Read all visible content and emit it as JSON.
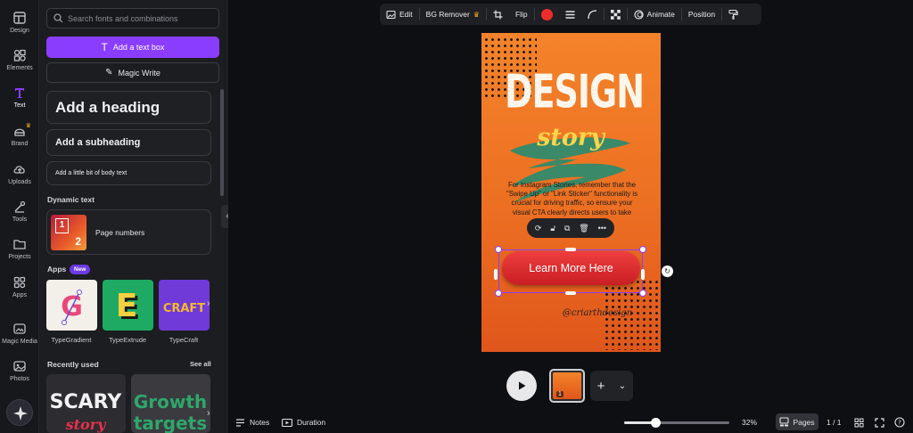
{
  "rail": {
    "items": [
      {
        "label": "Design",
        "icon": "design-icon"
      },
      {
        "label": "Elements",
        "icon": "elements-icon"
      },
      {
        "label": "Text",
        "icon": "text-icon"
      },
      {
        "label": "Brand",
        "icon": "brand-icon"
      },
      {
        "label": "Uploads",
        "icon": "uploads-icon"
      },
      {
        "label": "Tools",
        "icon": "tools-icon"
      },
      {
        "label": "Projects",
        "icon": "projects-icon"
      },
      {
        "label": "Apps",
        "icon": "apps-icon"
      },
      {
        "label": "Magic Media",
        "icon": "magic-media-icon"
      },
      {
        "label": "Photos",
        "icon": "photos-icon"
      }
    ],
    "active": "Text"
  },
  "panel": {
    "search_placeholder": "Search fonts and combinations",
    "add_text_box": "Add a text box",
    "magic_write": "Magic Write",
    "heading": "Add a heading",
    "subheading": "Add a subheading",
    "body_text": "Add a little bit of body text",
    "dynamic_text_label": "Dynamic text",
    "page_numbers": "Page numbers",
    "page_numbers_thumb_1": "1",
    "page_numbers_thumb_2": "2",
    "apps_label": "Apps",
    "apps_badge": "New",
    "apps": [
      {
        "label": "TypeGradient",
        "glyph": "G"
      },
      {
        "label": "TypeExtrude",
        "glyph": "E"
      },
      {
        "label": "TypeCraft",
        "glyph": "CRAFT"
      }
    ],
    "recently_used_label": "Recently used",
    "see_all": "See all",
    "recent": [
      {
        "line1": "SCARY",
        "line2": "story"
      },
      {
        "line1": "Growth",
        "line2": "targets"
      }
    ]
  },
  "toolbar": {
    "edit": "Edit",
    "bg_remover": "BG Remover",
    "flip": "Flip",
    "animate": "Animate",
    "position": "Position",
    "fill_color": "#ef2c2c"
  },
  "design": {
    "title": "DESIGN",
    "subtitle": "story",
    "body": "For Instagram Stories, remember that the \"Swipe Up\" or \"Link Sticker\" functionality is crucial for driving traffic, so ensure your visual CTA clearly directs users to take action.",
    "cta": "Learn More Here",
    "handle": "@criarthdesign"
  },
  "pages": {
    "thumb_number": "1"
  },
  "bottombar": {
    "notes": "Notes",
    "duration": "Duration",
    "zoom": "32%",
    "zoom_fraction": 0.3,
    "pages_label": "Pages",
    "page_count": "1 / 1"
  }
}
